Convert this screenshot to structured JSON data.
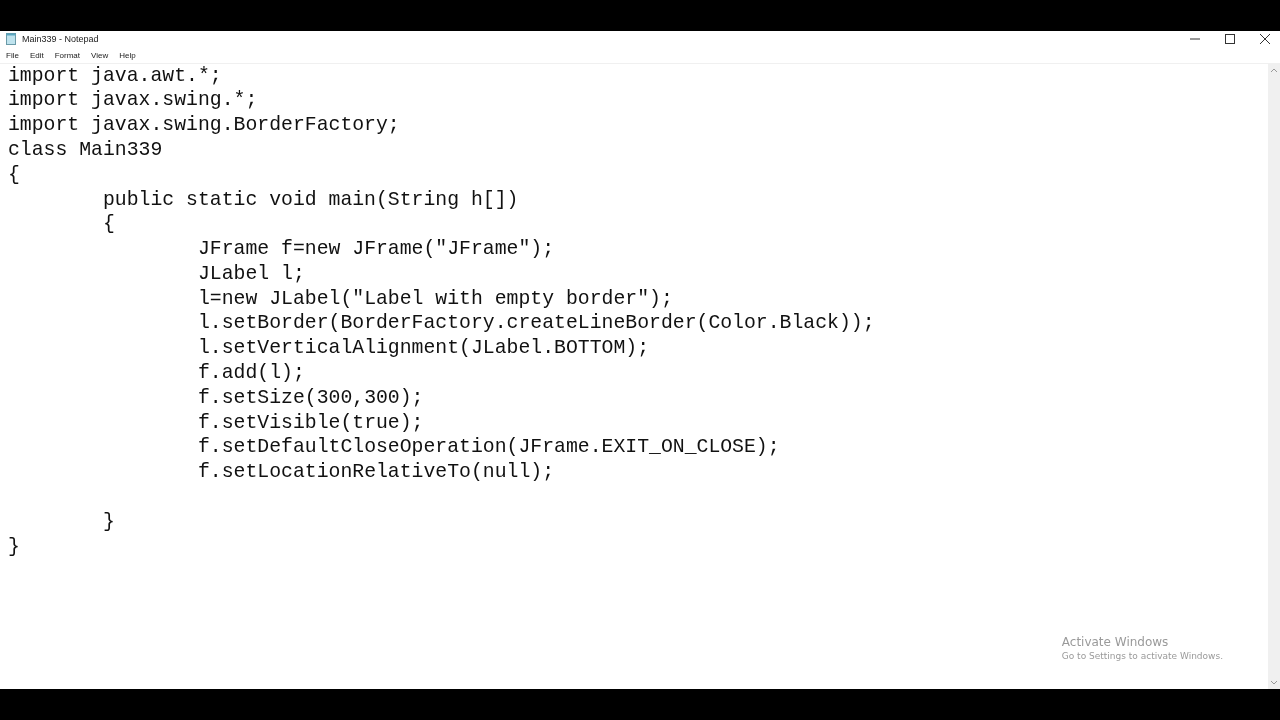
{
  "window": {
    "title": "Main339 - Notepad"
  },
  "menu": [
    "File",
    "Edit",
    "Format",
    "View",
    "Help"
  ],
  "editor": {
    "paragraphs": [
      [
        "import java.awt.*;",
        "import javax.swing.*;",
        "import javax.swing.BorderFactory;",
        "class Main339",
        "{",
        "\tpublic static void main(String h[])",
        "\t{",
        "\t\tJFrame f=new JFrame(\"JFrame\");",
        "\t\tJLabel l;",
        "\t\tl=new JLabel(\"Label with empty border\");",
        "\t\tl.setBorder(BorderFactory.createLineBorder(Color.Black));",
        "\t\tl.setVerticalAlignment(JLabel.BOTTOM);",
        "\t\tf.add(l);",
        "\t\tf.setSize(300,300);",
        "\t\tf.setVisible(true);",
        "\t\tf.setDefaultCloseOperation(JFrame.EXIT_ON_CLOSE);",
        "\t\tf.setLocationRelativeTo(null);"
      ],
      [
        "\t}",
        "}"
      ]
    ]
  },
  "activation": {
    "title": "Activate Windows",
    "message": "Go to Settings to activate Windows."
  }
}
